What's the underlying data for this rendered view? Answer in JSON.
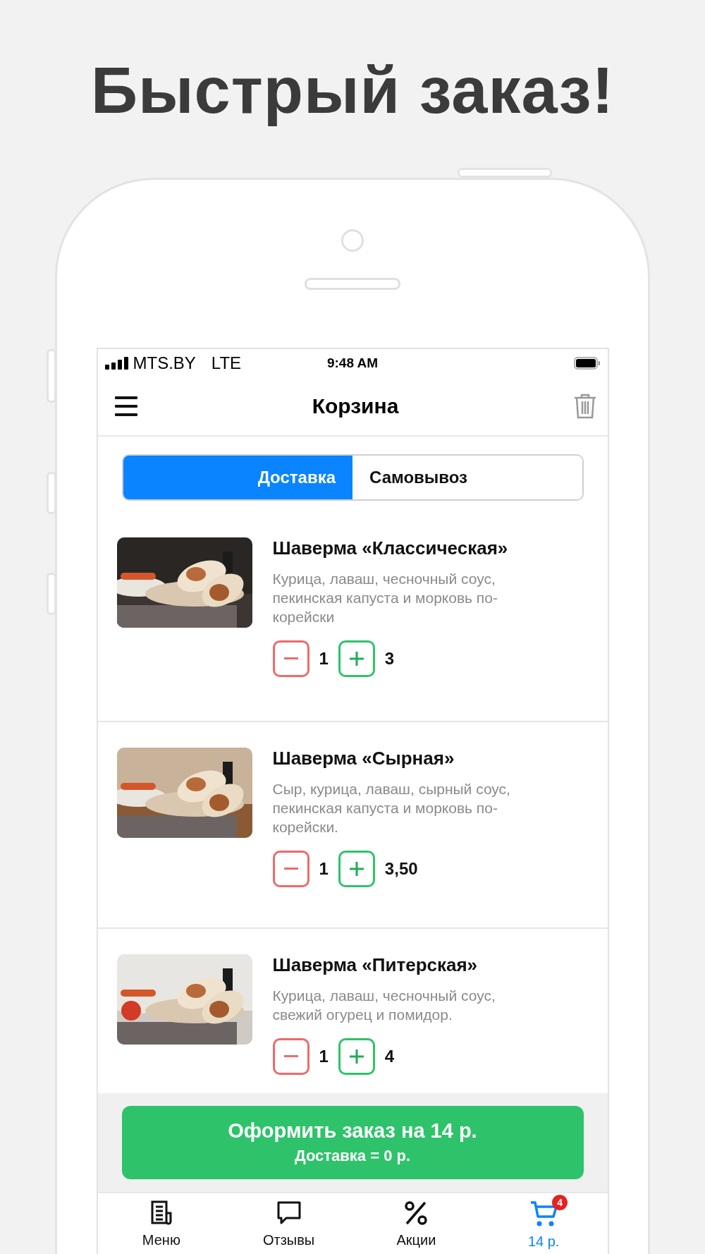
{
  "headline": "Быстрый заказ!",
  "status_bar": {
    "carrier": "MTS.BY",
    "network": "LTE",
    "time": "9:48 AM"
  },
  "header": {
    "title": "Корзина"
  },
  "tabs": [
    {
      "label": "Доставка",
      "selected": true
    },
    {
      "label": "Самовывоз",
      "selected": false
    }
  ],
  "items": [
    {
      "name": "Шаверма «Классическая»",
      "description": "Курица, лаваш, чесночный соус, пекинская капуста и морковь по-корейски",
      "quantity": "1",
      "price": "3"
    },
    {
      "name": "Шаверма «Сырная»",
      "description": "Сыр, курица, лаваш, сырный соус, пекинская капуста и морковь по-корейски.",
      "quantity": "1",
      "price": "3,50"
    },
    {
      "name": "Шаверма «Питерская»",
      "description": "Курица, лаваш, чесночный соус, свежий огурец и помидор.",
      "quantity": "1",
      "price": "4"
    }
  ],
  "order_button": {
    "label": "Оформить заказ на 14 р.",
    "sublabel": "Доставка = 0 р."
  },
  "tab_bar": [
    {
      "label": "Меню",
      "selected": false
    },
    {
      "label": "Отзывы",
      "selected": false
    },
    {
      "label": "Акции",
      "selected": false
    },
    {
      "label": "14 р.",
      "selected": true,
      "badge": "4"
    }
  ]
}
